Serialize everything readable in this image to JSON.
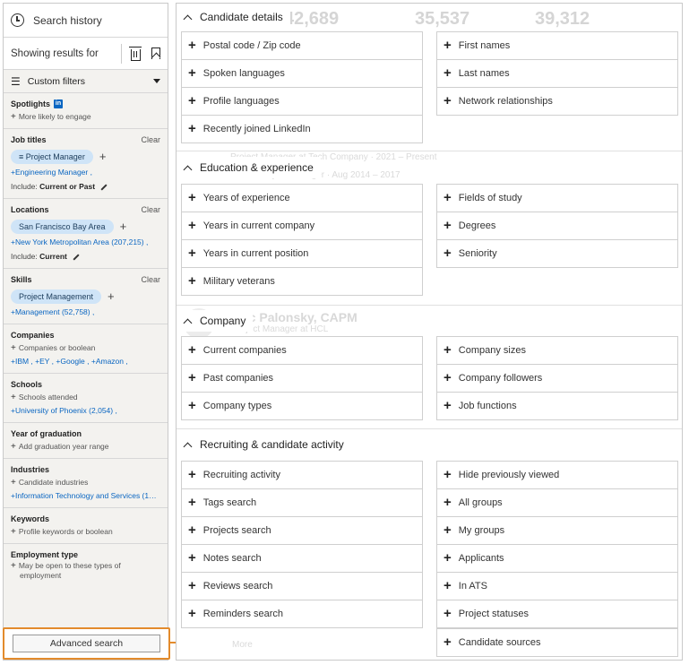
{
  "sidebar": {
    "search_history": "Search history",
    "showing_results": "Showing results for",
    "custom_filters": "Custom filters",
    "spotlights": {
      "title": "Spotlights",
      "badge": "in",
      "line": "More likely to engage"
    },
    "job_titles": {
      "title": "Job titles",
      "clear": "Clear",
      "pill": "Project Manager",
      "pill_icon": "≡",
      "link": "+Engineering Manager ,",
      "include_label": "Include:",
      "include_value": "Current or Past"
    },
    "locations": {
      "title": "Locations",
      "clear": "Clear",
      "pill": "San Francisco Bay Area",
      "link": "+New York Metropolitan Area (207,215) ,",
      "include_label": "Include:",
      "include_value": "Current"
    },
    "skills": {
      "title": "Skills",
      "clear": "Clear",
      "pill": "Project Management",
      "link": "+Management (52,758) ,"
    },
    "companies": {
      "title": "Companies",
      "line": "Companies or boolean",
      "link": "+IBM , +EY , +Google , +Amazon ,"
    },
    "schools": {
      "title": "Schools",
      "line": "Schools attended",
      "link": "+University of Phoenix (2,054) ,"
    },
    "year_of_graduation": {
      "title": "Year of graduation",
      "line": "Add graduation year range"
    },
    "industries": {
      "title": "Industries",
      "line": "Candidate industries",
      "link": "+Information Technology and Services (16,..."
    },
    "keywords": {
      "title": "Keywords",
      "line": "Profile keywords or boolean"
    },
    "employment_type": {
      "title": "Employment type",
      "line1": "May be open to these types of",
      "line2": "employment"
    },
    "advanced_search": "Advanced search"
  },
  "background": {
    "stats": [
      "42,689",
      "35,537",
      "39,312"
    ],
    "ghost_lines": [
      "Project Manager at Tech Company · 2021 – Present",
      "Senior Project Manager · Aug 2014 – 2017",
      "Eric Palonsky, CAPM",
      "Project Manager at HCL"
    ],
    "ghost_more": "More"
  },
  "groups": [
    {
      "title": "Candidate details",
      "left": [
        "Postal code / Zip code",
        "Spoken languages",
        "Profile languages",
        "Recently joined LinkedIn"
      ],
      "right": [
        "First names",
        "Last names",
        "Network relationships"
      ]
    },
    {
      "title": "Education & experience",
      "left": [
        "Years of experience",
        "Years in current company",
        "Years in current position",
        "Military veterans"
      ],
      "right": [
        "Fields of study",
        "Degrees",
        "Seniority"
      ]
    },
    {
      "title": "Company",
      "left": [
        "Current companies",
        "Past companies",
        "Company types"
      ],
      "right": [
        "Company sizes",
        "Company followers",
        "Job functions"
      ]
    },
    {
      "title": "Recruiting & candidate activity",
      "left": [
        "Recruiting activity",
        "Tags search",
        "Projects search",
        "Notes search",
        "Reviews search",
        "Reminders search"
      ],
      "right": [
        "Hide previously viewed",
        "All groups",
        "My groups",
        "Applicants",
        "In ATS",
        "Project statuses",
        "Candidate sources"
      ]
    }
  ],
  "colors": {
    "accent_orange": "#e38b2c",
    "linkedin_blue": "#0a66c2",
    "pill_bg": "#cfe4f7"
  }
}
